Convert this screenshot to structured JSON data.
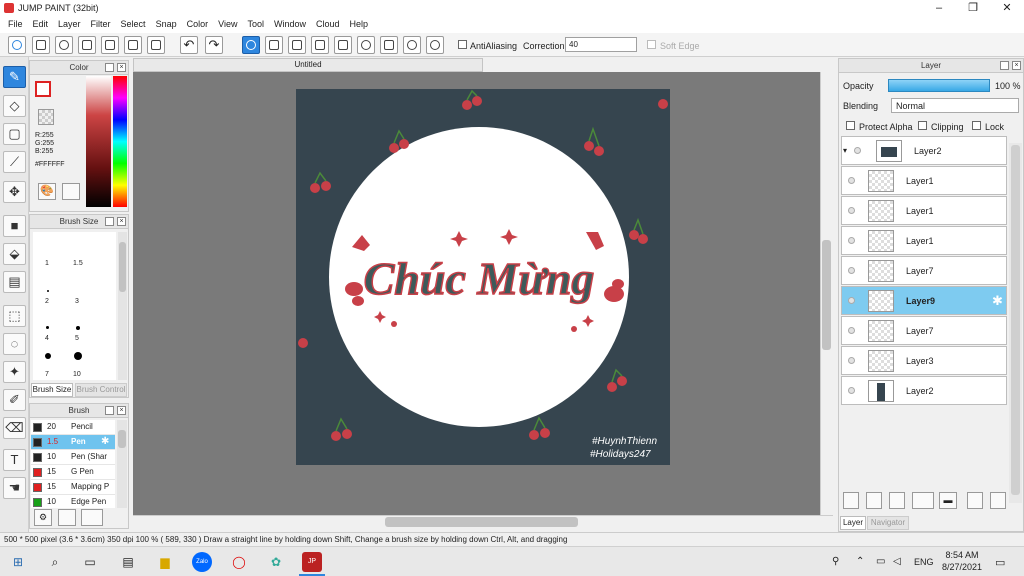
{
  "window": {
    "title": "JUMP PAINT (32bit)",
    "minimize": "–",
    "maximize": "❐",
    "close": "✕"
  },
  "menu": [
    "File",
    "Edit",
    "Layer",
    "Filter",
    "Select",
    "Snap",
    "Color",
    "View",
    "Tool",
    "Window",
    "Cloud",
    "Help"
  ],
  "toolbar": {
    "antialiasing_label": "AntiAliasing",
    "correction_label": "Correction",
    "correction_value": "40",
    "soft_edge_label": "Soft Edge"
  },
  "color_panel": {
    "title": "Color",
    "rgb": {
      "r": "R:255",
      "g": "G:255",
      "b": "B:255"
    },
    "hex": "#FFFFFF",
    "foreground": "#ffffff"
  },
  "brush_size_panel": {
    "title": "Brush Size",
    "sizes": [
      "1",
      "1.5",
      "2",
      "3",
      "4",
      "5",
      "7",
      "10"
    ],
    "tab_brush_size": "Brush Size",
    "tab_brush_control": "Brush Control"
  },
  "brush_panel": {
    "title": "Brush",
    "items": [
      {
        "size": "20",
        "name": "Pencil",
        "color": "#222222"
      },
      {
        "size": "1.5",
        "name": "Pen",
        "color": "#222222",
        "selected": true
      },
      {
        "size": "10",
        "name": "Pen (Shar",
        "color": "#222222"
      },
      {
        "size": "15",
        "name": "G Pen",
        "color": "#e02020"
      },
      {
        "size": "15",
        "name": "Mapping P",
        "color": "#e02020"
      },
      {
        "size": "10",
        "name": "Edge Pen",
        "color": "#18a018"
      }
    ]
  },
  "document": {
    "tab": "Untitled",
    "artwork_text": "Chúc Mừng",
    "signature_line1": "#HuynhThienn",
    "signature_line2": "#Holidays247"
  },
  "layer_panel": {
    "title": "Layer",
    "opacity_label": "Opacity",
    "opacity_value": "100 %",
    "blending_label": "Blending",
    "blending_value": "Normal",
    "protect_alpha": "Protect Alpha",
    "clipping": "Clipping",
    "lock": "Lock",
    "layers": [
      {
        "name": "Layer2",
        "folder": true
      },
      {
        "name": "Layer1"
      },
      {
        "name": "Layer1"
      },
      {
        "name": "Layer1"
      },
      {
        "name": "Layer7"
      },
      {
        "name": "Layer9",
        "selected": true
      },
      {
        "name": "Layer7"
      },
      {
        "name": "Layer3"
      },
      {
        "name": "Layer2"
      }
    ],
    "tab_layer": "Layer",
    "tab_navigator": "Navigator"
  },
  "status": {
    "text": "500 * 500 pixel   (3.6 * 3.6cm)   350 dpi   100 %   ( 589, 330 )   Draw a straight line by holding down Shift, Change a brush size by holding down Ctrl, Alt, and dragging"
  },
  "taskbar": {
    "lang": "ENG",
    "time": "8:54 AM",
    "date": "8/27/2021",
    "zalo": "Zalo"
  },
  "colors": {
    "accent": "#2e86de",
    "artboard": "#36454f",
    "cherry": "#c84048",
    "selection": "#7ecbf0"
  }
}
